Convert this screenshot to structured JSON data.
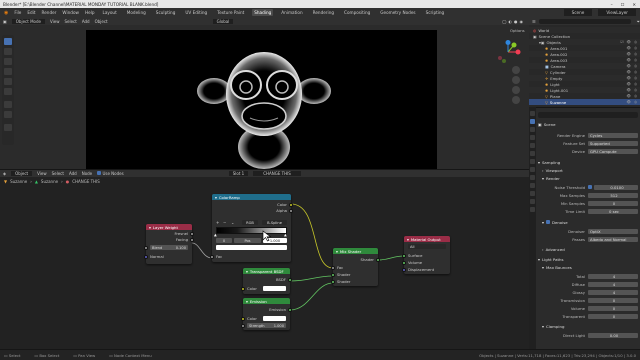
{
  "window": {
    "title": "Blender* [E:\\Blender Channel\\MATERIAL MONDAY TUTORIAL BLANK.blend]"
  },
  "menu": {
    "items": [
      "File",
      "Edit",
      "Render",
      "Window",
      "Help"
    ],
    "workspaces": [
      "Layout",
      "Modeling",
      "Sculpting",
      "UV Editing",
      "Texture Paint",
      "Shading",
      "Animation",
      "Rendering",
      "Compositing",
      "Geometry Nodes",
      "Scripting"
    ],
    "active_workspace": "Shading",
    "scene": "Scene",
    "view_layer": "ViewLayer"
  },
  "viewport": {
    "mode": "Object Mode",
    "menus": [
      "View",
      "Select",
      "Add",
      "Object"
    ],
    "orientation": "Global",
    "options": "Options"
  },
  "node_editor": {
    "editor": "Object",
    "menus": [
      "View",
      "Select",
      "Add",
      "Node"
    ],
    "use_nodes": "Use Nodes",
    "slot": "Slot 1",
    "material": "CHANGE THIS",
    "breadcrumb": [
      "Suzanne",
      "Suzanne",
      "CHANGE THIS"
    ],
    "nodes": {
      "layer_weight": {
        "title": "Layer Weight",
        "out1": "Fresnel",
        "out2": "Facing",
        "blend_label": "Blend",
        "blend_value": "0.100",
        "normal": "Normal"
      },
      "color_ramp": {
        "title": "ColorRamp",
        "out1": "Color",
        "out2": "Alpha",
        "mode": "RGB",
        "interp": "B-Spline",
        "pos_index": "0",
        "pos_label": "Pos",
        "pos_value": "1.000",
        "fac": "Fac"
      },
      "transparent": {
        "title": "Transparent BSDF",
        "out": "BSDF",
        "color": "Color"
      },
      "emission": {
        "title": "Emission",
        "out": "Emission",
        "color": "Color",
        "strength_label": "Strength",
        "strength_value": "1.000"
      },
      "mix_shader": {
        "title": "Mix Shader",
        "out": "Shader",
        "in1": "Fac",
        "in2": "Shader",
        "in3": "Shader"
      },
      "material_output": {
        "title": "Material Output",
        "target": "All",
        "in1": "Surface",
        "in2": "Volume",
        "in3": "Displacement"
      }
    }
  },
  "outliner": {
    "search": "",
    "rows": [
      {
        "label": "World",
        "indent": 0
      },
      {
        "label": "Scene Collection",
        "indent": 0
      },
      {
        "label": "Objects",
        "indent": 1
      },
      {
        "label": "Area.001",
        "indent": 2
      },
      {
        "label": "Area.002",
        "indent": 2
      },
      {
        "label": "Area.003",
        "indent": 2
      },
      {
        "label": "Camera",
        "indent": 2
      },
      {
        "label": "Cylinder",
        "indent": 2
      },
      {
        "label": "Empty",
        "indent": 2
      },
      {
        "label": "Light",
        "indent": 2
      },
      {
        "label": "Light.001",
        "indent": 2
      },
      {
        "label": "Plane",
        "indent": 2
      },
      {
        "label": "Suzanne",
        "indent": 2,
        "selected": true
      }
    ]
  },
  "properties": {
    "scene_name": "Scene",
    "render_engine_label": "Render Engine",
    "render_engine": "Cycles",
    "feature_set_label": "Feature Set",
    "feature_set": "Supported",
    "device_label": "Device",
    "device": "GPU Compute",
    "sampling": "Sampling",
    "viewport": "Viewport",
    "render": "Render",
    "noise_threshold_label": "Noise Threshold",
    "noise_threshold": "0.0100",
    "max_samples_label": "Max Samples",
    "max_samples": "512",
    "min_samples_label": "Min Samples",
    "min_samples": "0",
    "time_limit_label": "Time Limit",
    "time_limit": "0 sec",
    "denoise": "Denoise",
    "denoiser_label": "Denoiser",
    "denoiser": "OptiX",
    "passes_label": "Passes",
    "passes": "Albedo and Normal",
    "advanced": "Advanced",
    "light_paths": "Light Paths",
    "max_bounces": "Max Bounces",
    "total_label": "Total",
    "total": "4",
    "diffuse_label": "Diffuse",
    "diffuse": "4",
    "glossy_label": "Glossy",
    "glossy": "4",
    "transmission_label": "Transmission",
    "transmission": "0",
    "volume_label": "Volume",
    "volume": "0",
    "transparent_label": "Transparent",
    "transparent": "0",
    "clamping": "Clamping",
    "direct_light_label": "Direct Light",
    "direct_light": "0.00"
  },
  "statusbar": {
    "select": "Select",
    "box_select": "Box Select",
    "pan": "Pan View",
    "context": "Node Context Menu",
    "stats": "Objects | Suzanne | Verts:11,718 | Faces:11,623 | Tris:23,294 | Objects:1/10 | 3.0.0"
  }
}
